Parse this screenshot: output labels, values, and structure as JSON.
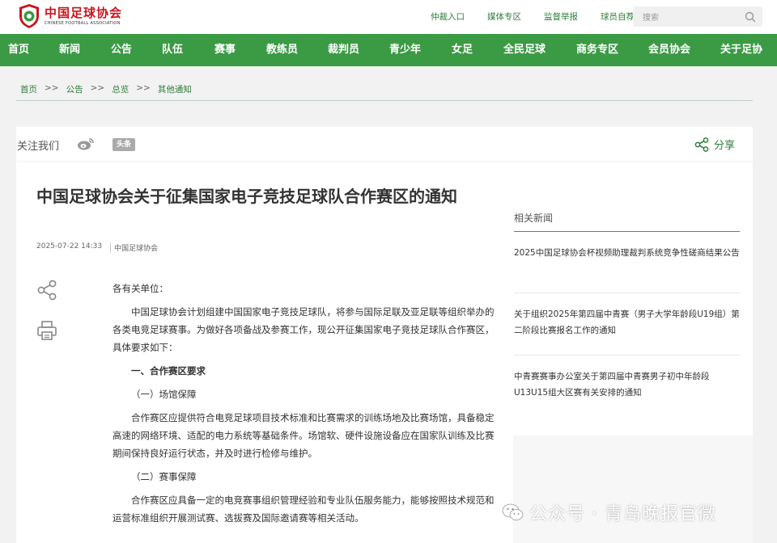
{
  "header": {
    "logo_cn": "中国足球协会",
    "logo_en": "CHINESE FOOTBALL ASSOCIATION",
    "top_links": [
      "仲裁入口",
      "媒体专区",
      "监督举报",
      "球员自荐"
    ],
    "search_placeholder": "搜索"
  },
  "nav": [
    "首页",
    "新闻",
    "公告",
    "队伍",
    "赛事",
    "教练员",
    "裁判员",
    "青少年",
    "女足",
    "全民足球",
    "商务专区",
    "会员协会",
    "关于足协"
  ],
  "breadcrumb": [
    "首页",
    "公告",
    "总览",
    "其他通知"
  ],
  "breadcrumb_sep": ">>",
  "follow": {
    "label": "关注我们",
    "toutiao": "头条",
    "share": "分享"
  },
  "article": {
    "title": "中国足球协会关于征集国家电子竞技足球队合作赛区的通知",
    "date": "2025-07-22 14:33",
    "source": "中国足球协会",
    "salutation": "各有关单位：",
    "para1": "中国足球协会计划组建中国国家电子竞技足球队，将参与国际足联及亚足联等组织举办的各类电竞足球赛事。为做好各项备战及参赛工作，现公开征集国家电子竞技足球队合作赛区，具体要求如下：",
    "heading1": "一、合作赛区要求",
    "sub1": "（一）场馆保障",
    "para2": "合作赛区应提供符合电竞足球项目技术标准和比赛需求的训练场地及比赛场馆，具备稳定高速的网络环境、适配的电力系统等基础条件。场馆软、硬件设施设备应在国家队训练及比赛期间保持良好运行状态，并及时进行检修与维护。",
    "sub2": "（二）赛事保障",
    "para3": "合作赛区应具备一定的电竞赛事组织管理经验和专业队伍服务能力，能够按照技术规范和运营标准组织开展测试赛、选拔赛及国际邀请赛等相关活动。"
  },
  "related": {
    "title": "相关新闻",
    "items": [
      "2025中国足球协会杯视频助理裁判系统竞争性磋商结果公告",
      "关于组织2025年第四届中青赛（男子大学年龄段U19组）第二阶段比赛报名工作的通知",
      "中青赛赛事办公室关于第四届中青赛男子初中年龄段U13U15组大区赛有关安排的通知"
    ]
  },
  "watermark": "公众号 · 青岛晚报官微",
  "colors": {
    "brand_green": "#3b9a44",
    "link_green": "#2f7d3c",
    "logo_red": "#c8161d"
  }
}
